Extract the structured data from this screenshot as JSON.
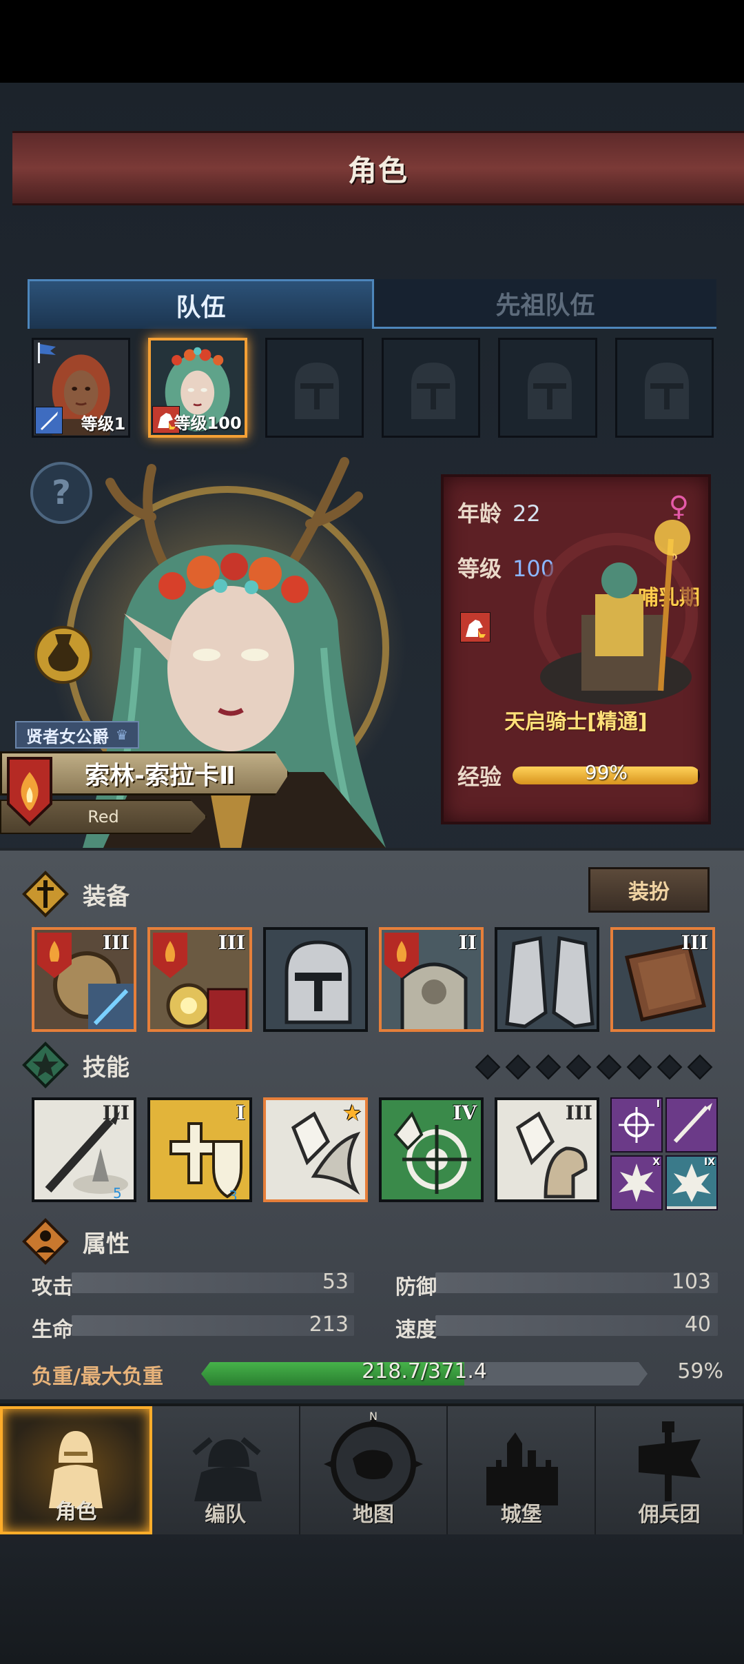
{
  "header": {
    "title": "角色"
  },
  "tabs": [
    {
      "label": "队伍",
      "active": true
    },
    {
      "label": "先祖队伍",
      "active": false
    }
  ],
  "roster": [
    {
      "level_text": "等级1",
      "hair": "#a0452a",
      "selected": false
    },
    {
      "level_text": "等级100",
      "hair": "#5fa38a",
      "selected": true
    },
    {
      "level_text": "",
      "empty": true
    },
    {
      "level_text": "",
      "empty": true
    },
    {
      "level_text": "",
      "empty": true
    },
    {
      "level_text": "",
      "empty": true
    }
  ],
  "hero": {
    "title_tag": "贤者女公爵",
    "name": "索林-索拉卡Ⅱ",
    "house": "Red"
  },
  "info_card": {
    "age_label": "年龄",
    "age_value": "22",
    "level_label": "等级",
    "level_value": "100",
    "gender_symbol": "♀",
    "stage": "哺乳期",
    "class_name": "天启骑士[精通]",
    "xp_label": "经验",
    "xp_text": "99%",
    "xp_fraction": 0.99
  },
  "equipment": {
    "section_title": "装备",
    "dress_button": "装扮",
    "items": [
      {
        "roman": "III",
        "rare": true,
        "icon": "amulet-icon"
      },
      {
        "roman": "III",
        "rare": true,
        "icon": "tome-icon"
      },
      {
        "roman": "",
        "rare": false,
        "icon": "helmet-icon"
      },
      {
        "roman": "II",
        "rare": true,
        "icon": "armor-icon"
      },
      {
        "roman": "",
        "rare": false,
        "icon": "greaves-icon"
      },
      {
        "roman": "III",
        "rare": true,
        "icon": "book-icon"
      }
    ]
  },
  "skills": {
    "section_title": "技能",
    "items": [
      {
        "roman": "III",
        "badge": "5",
        "icon": "spear-strike-icon"
      },
      {
        "roman": "I",
        "badge": "3",
        "icon": "holy-shield-icon"
      },
      {
        "roman": "★",
        "badge": "",
        "icon": "crystal-wing-icon"
      },
      {
        "roman": "IV",
        "badge": "",
        "icon": "target-icon"
      },
      {
        "roman": "III",
        "badge": "",
        "icon": "crystal-fist-icon"
      }
    ],
    "minis": [
      {
        "roman": "I",
        "icon": "sun-target-icon"
      },
      {
        "roman": "",
        "icon": "javelin-icon"
      },
      {
        "roman": "X",
        "icon": "burst-icon"
      },
      {
        "roman": "IX",
        "icon": "shatter-icon"
      }
    ]
  },
  "attributes": {
    "section_title": "属性",
    "attack_label": "攻击",
    "attack_value": "53",
    "defense_label": "防御",
    "defense_value": "103",
    "hp_label": "生命",
    "hp_value": "213",
    "speed_label": "速度",
    "speed_value": "40",
    "load_label": "负重/最大负重",
    "load_text": "218.7/371.4",
    "load_pct": "59%",
    "load_fraction": 0.59
  },
  "nav": [
    {
      "label": "角色",
      "active": true
    },
    {
      "label": "编队",
      "active": false
    },
    {
      "label": "地图",
      "active": false
    },
    {
      "label": "城堡",
      "active": false
    },
    {
      "label": "佣兵团",
      "active": false
    }
  ],
  "colors": {
    "accent": "#ffad2a",
    "rare_border": "#e67f3a",
    "tab_active": "#2c5278",
    "card_bg": "#5d2025"
  }
}
